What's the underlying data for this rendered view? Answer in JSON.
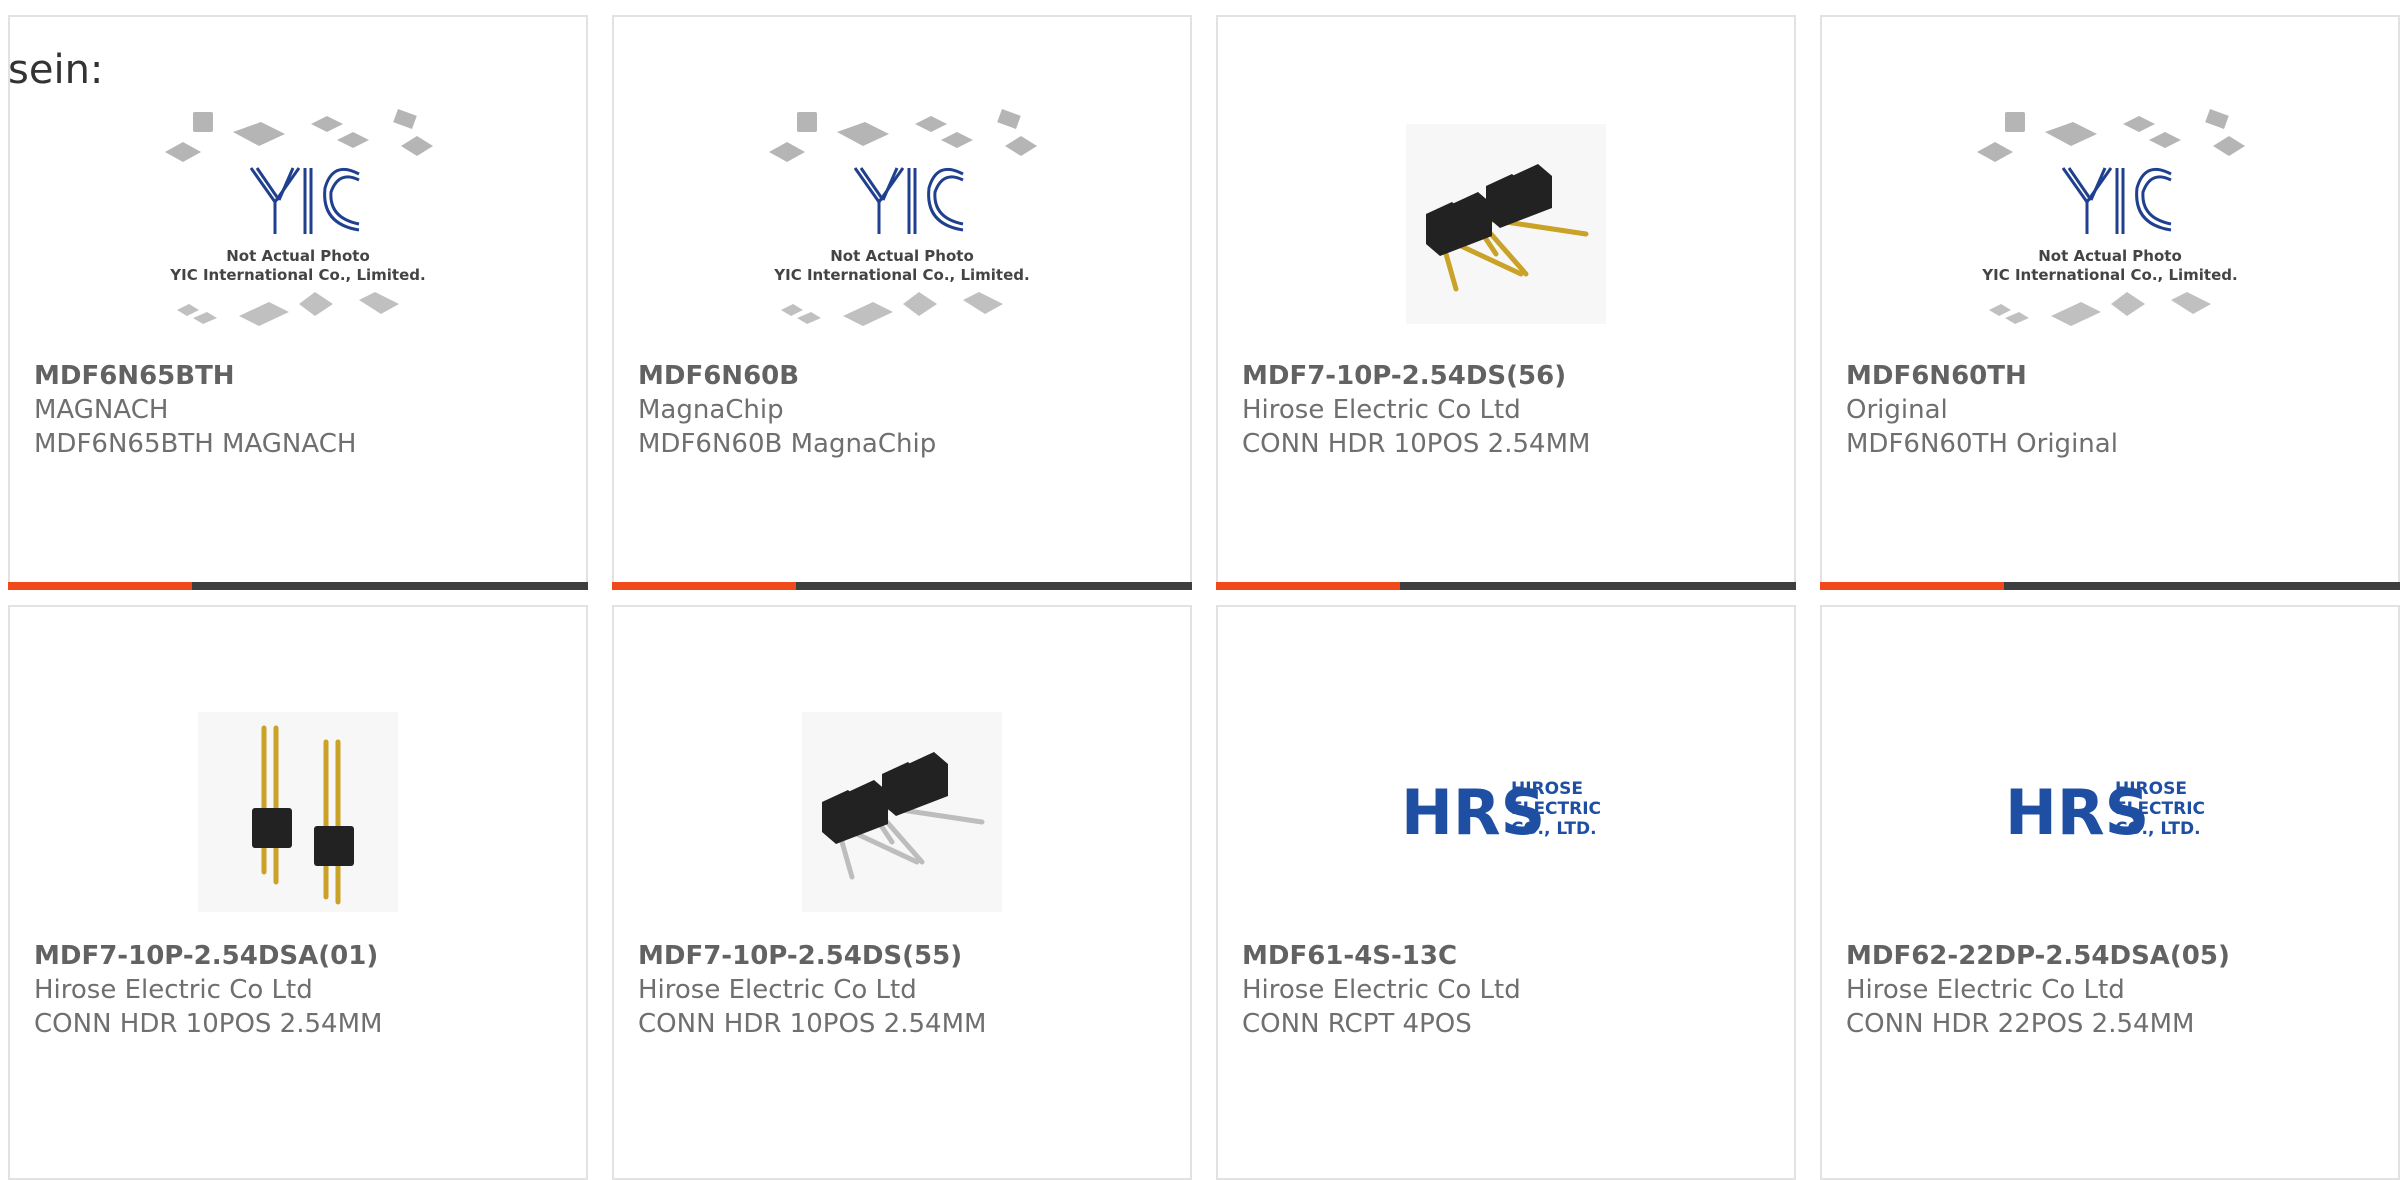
{
  "intro_text": "sein:",
  "colors": {
    "accent": "#f04a1a",
    "bar": "#3e3e3e",
    "card_border": "#e2e2e2",
    "text": "#6f6f6f"
  },
  "products": [
    {
      "part_number": "MDF6N65BTH",
      "manufacturer": "MAGNACH",
      "description": "MDF6N65BTH MAGNACH",
      "image": "yic-placeholder",
      "image_caption_1": "Not Actual Photo",
      "image_caption_2": "YIC International Co., Limited.",
      "image_logo": "YIC",
      "show_bar": true
    },
    {
      "part_number": "MDF6N60B",
      "manufacturer": "MagnaChip",
      "description": "MDF6N60B MagnaChip",
      "image": "yic-placeholder",
      "image_caption_1": "Not Actual Photo",
      "image_caption_2": "YIC International Co., Limited.",
      "image_logo": "YIC",
      "show_bar": true
    },
    {
      "part_number": "MDF7-10P-2.54DS(56)",
      "manufacturer": "Hirose Electric Co Ltd",
      "description": "CONN HDR 10POS 2.54MM",
      "image": "pin-header-right-angle",
      "show_bar": true
    },
    {
      "part_number": "MDF6N60TH",
      "manufacturer": "Original",
      "description": "MDF6N60TH Original",
      "image": "yic-placeholder",
      "image_caption_1": "Not Actual Photo",
      "image_caption_2": "YIC International Co., Limited.",
      "image_logo": "YIC",
      "show_bar": true
    },
    {
      "part_number": "MDF7-10P-2.54DSA(01)",
      "manufacturer": "Hirose Electric Co Ltd",
      "description": "CONN HDR 10POS 2.54MM",
      "image": "pin-header-vertical",
      "show_bar": false
    },
    {
      "part_number": "MDF7-10P-2.54DS(55)",
      "manufacturer": "Hirose Electric Co Ltd",
      "description": "CONN HDR 10POS 2.54MM",
      "image": "pin-header-right-angle-silver",
      "show_bar": false
    },
    {
      "part_number": "MDF61-4S-13C",
      "manufacturer": "Hirose Electric Co Ltd",
      "description": "CONN RCPT 4POS",
      "image": "hrs-logo",
      "image_logo": "HRS",
      "image_logo_lines": [
        "HIROSE",
        "ELECTRIC",
        "CO., LTD."
      ],
      "show_bar": false
    },
    {
      "part_number": "MDF62-22DP-2.54DSA(05)",
      "manufacturer": "Hirose Electric Co Ltd",
      "description": "CONN HDR 22POS 2.54MM",
      "image": "hrs-logo",
      "image_logo": "HRS",
      "image_logo_lines": [
        "HIROSE",
        "ELECTRIC",
        "CO., LTD."
      ],
      "show_bar": false
    }
  ]
}
